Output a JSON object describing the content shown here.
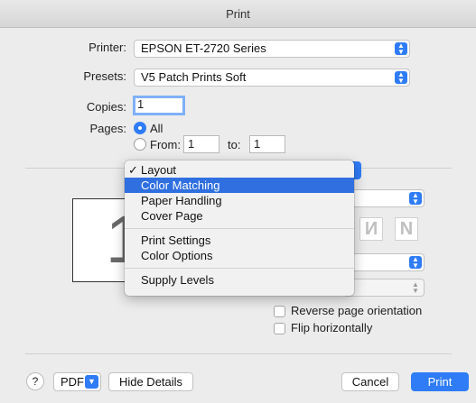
{
  "window": {
    "title": "Print"
  },
  "printer": {
    "label": "Printer:",
    "value": "EPSON ET-2720 Series"
  },
  "presets": {
    "label": "Presets:",
    "value": "V5 Patch Prints Soft"
  },
  "copies": {
    "label": "Copies:",
    "value": "1"
  },
  "pages": {
    "label": "Pages:",
    "all_label": "All",
    "from_label": "From:",
    "from_value": "1",
    "to_label": "to:",
    "to_value": "1",
    "selected": "All"
  },
  "preview": {
    "page_number": "1"
  },
  "section_menu": {
    "items": [
      {
        "label": "Layout",
        "checked": true
      },
      {
        "label": "Color Matching",
        "highlighted": true
      },
      {
        "label": "Paper Handling"
      },
      {
        "label": "Cover Page"
      },
      {
        "label": "Print Settings"
      },
      {
        "label": "Color Options"
      },
      {
        "label": "Supply Levels"
      }
    ],
    "check_glyph": "✓"
  },
  "layout_options": {
    "reverse_orientation_label": "Reverse page orientation",
    "flip_horizontally_label": "Flip horizontally"
  },
  "footer": {
    "help_label": "?",
    "pdf_label": "PDF",
    "hide_details_label": "Hide Details",
    "cancel_label": "Cancel",
    "print_label": "Print"
  },
  "colors": {
    "accent": "#2f7cf6",
    "menu_highlight": "#2f6fdf"
  }
}
